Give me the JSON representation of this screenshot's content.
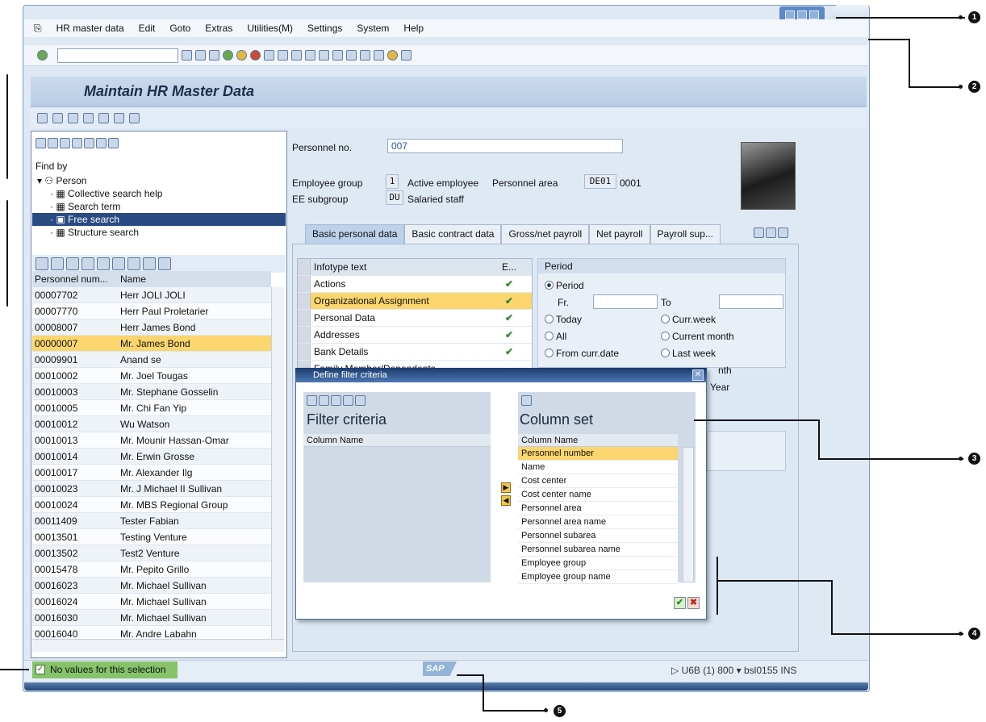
{
  "menu": [
    "HR master data",
    "Edit",
    "Goto",
    "Extras",
    "Utilities(M)",
    "Settings",
    "System",
    "Help"
  ],
  "page_title": "Maintain HR Master Data",
  "find_by": {
    "title": "Find by",
    "root": "Person",
    "items": [
      "Collective search help",
      "Search term",
      "Free search",
      "Structure search"
    ]
  },
  "list": {
    "col_personnel": "Personnel num...",
    "col_name": "Name",
    "rows": [
      [
        "00007702",
        "Herr JOLI JOLI"
      ],
      [
        "00007770",
        "Herr Paul Proletarier"
      ],
      [
        "00008007",
        "Herr James Bond"
      ],
      [
        "00000007",
        "Mr. James Bond"
      ],
      [
        "00009901",
        "Anand se"
      ],
      [
        "00010002",
        "Mr. Joel Tougas"
      ],
      [
        "00010003",
        "Mr. Stephane Gosselin"
      ],
      [
        "00010005",
        "Mr. Chi Fan Yip"
      ],
      [
        "00010012",
        "Wu Watson"
      ],
      [
        "00010013",
        "Mr. Mounir Hassan-Omar"
      ],
      [
        "00010014",
        "Mr. Erwin Grosse"
      ],
      [
        "00010017",
        "Mr. Alexander Ilg"
      ],
      [
        "00010023",
        "Mr. J Michael II Sullivan"
      ],
      [
        "00010024",
        "Mr. MBS Regional Group"
      ],
      [
        "00011409",
        "Tester Fabian"
      ],
      [
        "00013501",
        "Testing Venture"
      ],
      [
        "00013502",
        "Test2 Venture"
      ],
      [
        "00015478",
        "Mr. Pepito Grillo"
      ],
      [
        "00016023",
        "Mr. Michael Sullivan"
      ],
      [
        "00016024",
        "Mr. Michael Sullivan"
      ],
      [
        "00016030",
        "Mr. Michael Sullivan"
      ],
      [
        "00016040",
        "Mr. Andre Labahn"
      ]
    ]
  },
  "employee": {
    "personnel_no_label": "Personnel no.",
    "personnel_no": "007",
    "group_label": "Employee group",
    "group_code": "1",
    "group_text": "Active employee",
    "area_label": "Personnel area",
    "area_code": "DE01",
    "area_text": "0001",
    "subgroup_label": "EE subgroup",
    "subgroup_code": "DU",
    "subgroup_text": "Salaried staff"
  },
  "tabs": [
    "Basic personal data",
    "Basic contract data",
    "Gross/net payroll",
    "Net payroll",
    "Payroll sup..."
  ],
  "infotype": {
    "col_text": "Infotype text",
    "col_e": "E...",
    "rows": [
      "Actions",
      "Organizational Assignment",
      "Personal Data",
      "Addresses",
      "Bank Details",
      "Family Member/Dependents"
    ]
  },
  "period": {
    "title": "Period",
    "period": "Period",
    "from": "Fr.",
    "to": "To",
    "today": "Today",
    "curr_week": "Curr.week",
    "all": "All",
    "current_month": "Current month",
    "from_curr_date": "From curr.date",
    "last_week": "Last week",
    "last_month_partial": "nth",
    "year_partial": "Year"
  },
  "dialog": {
    "title": "Define filter criteria",
    "filter_title": "Filter criteria",
    "filter_col": "Column Name",
    "colset_title": "Column set",
    "colset_col": "Column Name",
    "columns": [
      "Personnel number",
      "Name",
      "Cost center",
      "Cost center name",
      "Personnel area",
      "Personnel area name",
      "Personnel subarea",
      "Personnel subarea name",
      "Employee group",
      "Employee group name"
    ]
  },
  "status": {
    "message": "No values for this selection",
    "logo": "SAP",
    "system": "U6B (1) 800",
    "host": "bsl0155",
    "mode": "INS"
  },
  "callouts": [
    "1",
    "2",
    "3",
    "4",
    "5"
  ]
}
